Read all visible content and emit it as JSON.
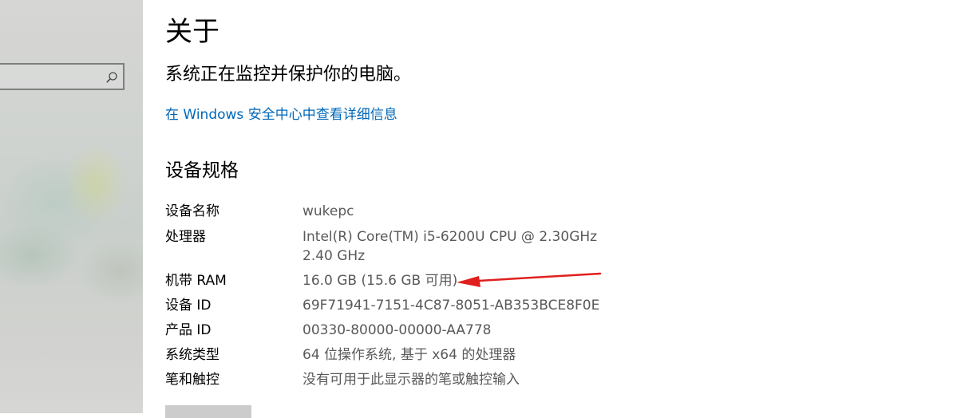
{
  "sidebar": {
    "search": {
      "placeholder": "",
      "icon": "search-icon"
    }
  },
  "main": {
    "title": "关于",
    "status": "系统正在监控并保护你的电脑。",
    "security_link": "在 Windows 安全中心中查看详细信息",
    "specs_title": "设备规格",
    "specs": [
      {
        "label": "设备名称",
        "value": "wukepc"
      },
      {
        "label": "处理器",
        "value": "Intel(R) Core(TM) i5-6200U CPU @ 2.30GHz\n2.40 GHz"
      },
      {
        "label": "机带 RAM",
        "value": "16.0 GB (15.6 GB 可用)"
      },
      {
        "label": "设备 ID",
        "value": "69F71941-7151-4C87-8051-AB353BCE8F0E"
      },
      {
        "label": "产品 ID",
        "value": "00330-80000-00000-AA778"
      },
      {
        "label": "系统类型",
        "value": "64 位操作系统, 基于 x64 的处理器"
      },
      {
        "label": "笔和触控",
        "value": "没有可用于此显示器的笔或触控输入"
      }
    ]
  },
  "annotation": {
    "type": "arrow",
    "color": "#e0201e"
  },
  "colors": {
    "link": "#0067b8",
    "value_text": "#595959"
  }
}
